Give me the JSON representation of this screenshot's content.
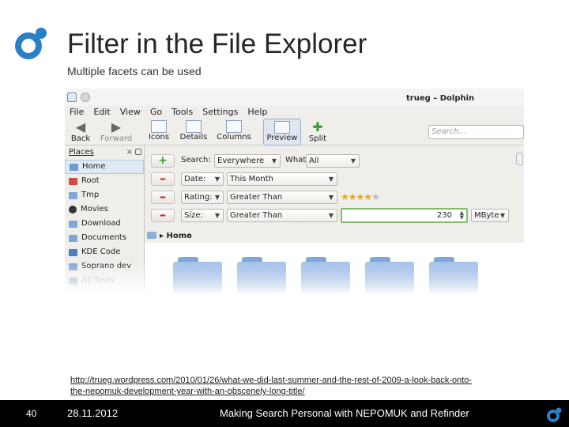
{
  "slide": {
    "title": "Filter in the File Explorer",
    "subtitle": "Multiple facets can be used",
    "url_line1": "http://trueg.wordpress.com/2010/01/26/what-we-did-last-summer-and-the-rest-of-2009-a-look-back-onto-",
    "url_line2": "the-nepomuk-development-year-with-an-obscenely-long-title/"
  },
  "footer": {
    "page_number": "40",
    "date": "28.11.2012",
    "title": "Making Search Personal with NEPOMUK and Refinder"
  },
  "dolphin": {
    "window_title": "trueg – Dolphin",
    "menu": [
      "File",
      "Edit",
      "View",
      "Go",
      "Tools",
      "Settings",
      "Help"
    ],
    "toolbar": {
      "back": "Back",
      "forward": "Forward",
      "icons": "Icons",
      "details": "Details",
      "columns": "Columns",
      "preview": "Preview",
      "split": "Split"
    },
    "search_placeholder": "Search...",
    "places": {
      "header": "Places",
      "items": [
        {
          "label": "Home",
          "icon": "home-folder-icon",
          "color": "#6d9bd3"
        },
        {
          "label": "Root",
          "icon": "root-folder-icon",
          "color": "#d24b3c"
        },
        {
          "label": "Tmp",
          "icon": "folder-icon",
          "color": "#7ea6d8"
        },
        {
          "label": "Movies",
          "icon": "movies-icon",
          "color": "#333333"
        },
        {
          "label": "Download",
          "icon": "folder-icon",
          "color": "#7ea6d8"
        },
        {
          "label": "Documents",
          "icon": "folder-icon",
          "color": "#7ea6d8"
        },
        {
          "label": "KDE Code",
          "icon": "kde-folder-icon",
          "color": "#4a7fc1"
        },
        {
          "label": "Soprano dev",
          "icon": "folder-icon",
          "color": "#7ea6d8"
        },
        {
          "label": "All Tasks",
          "icon": "tasks-icon",
          "color": "#9ab0c8"
        }
      ]
    },
    "filters": {
      "search_label": "Search:",
      "search_value": "Everywhere",
      "what_label": "What:",
      "what_value": "All",
      "date_field": "Date:",
      "date_value": "This Month",
      "rating_field": "Rating:",
      "rating_op": "Greater Than",
      "rating_value": 4,
      "rating_max": 5,
      "size_field": "Size:",
      "size_op": "Greater Than",
      "size_value": "230",
      "size_unit": "MByte"
    },
    "location": "Home"
  }
}
